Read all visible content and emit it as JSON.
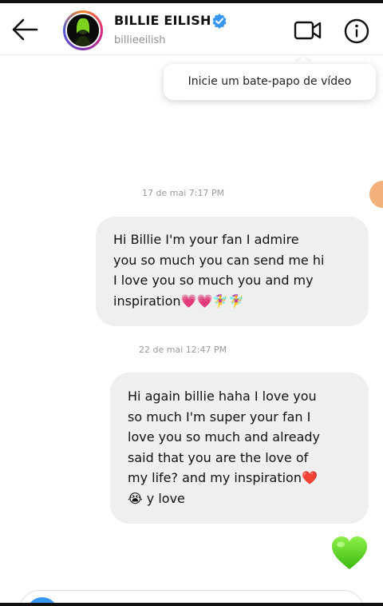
{
  "header": {
    "display_name": "BILLIE EILISH",
    "username": "billieeilish",
    "verified": true
  },
  "tooltip": {
    "text": "Inicie um bate-papo de vídeo"
  },
  "messages": [
    {
      "timestamp": "17 de mai 7:17 PM",
      "text": "Hi Billie I'm your fan I admire\nyou so much you can send me hi\nI love you so much you and my\ninspiration💗💗🧚‍♀️🧚‍♀️"
    },
    {
      "timestamp": "22 de mai 12:47 PM",
      "text": "Hi again billie haha I love you\nso much I'm super your fan I\nlove you so much and already\nsaid that you are the love of\nmy life? and my inspiration❤️\n😭 y love"
    }
  ],
  "reaction": {
    "icon": "green-heart-icon",
    "color": "#5fd11a"
  },
  "colors": {
    "verified_blue": "#3897f0",
    "bubble_bg": "#efefef",
    "timestamp_gray": "#9a9a9a"
  }
}
